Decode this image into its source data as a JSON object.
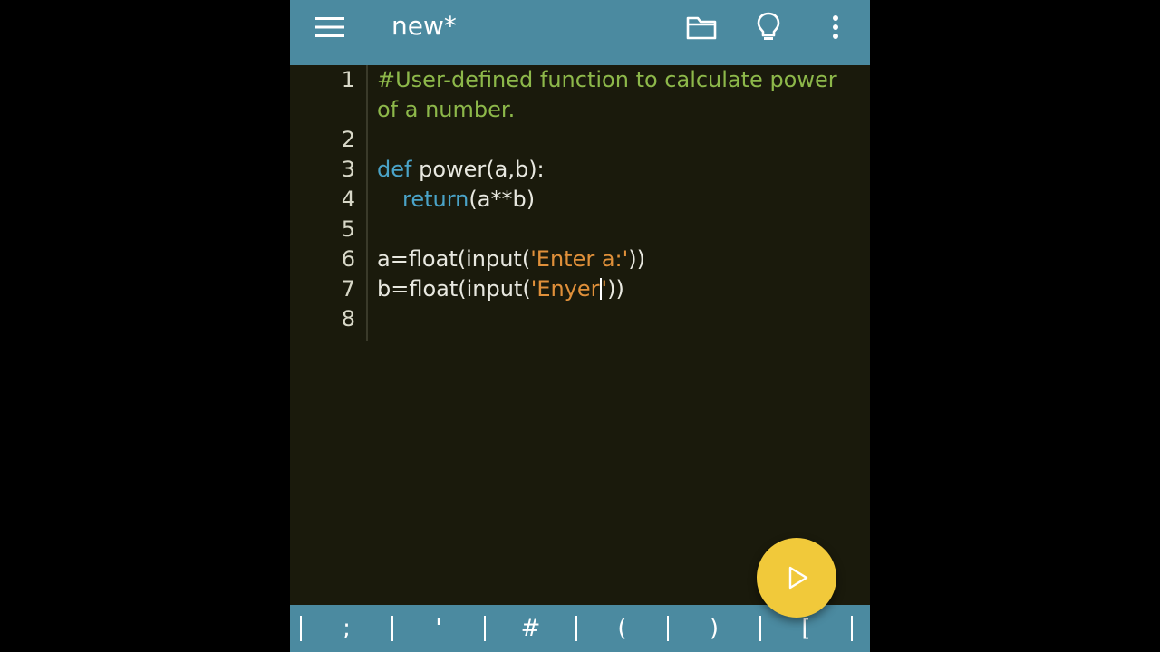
{
  "toolbar": {
    "title": "new*",
    "icons": [
      "menu-icon",
      "folder-icon",
      "lightbulb-icon",
      "more-vertical-icon"
    ],
    "background": "#4b8aa0"
  },
  "editor": {
    "lines": [
      {
        "number": "1",
        "text_a": "#User-defined function to calculate power",
        "text_b": "of a number."
      },
      {
        "number": "2",
        "text": ""
      },
      {
        "number": "3",
        "keyword": "def",
        "text": " power(a,b):"
      },
      {
        "number": "4",
        "keyword": "return",
        "text": "(a**b)"
      },
      {
        "number": "5",
        "text": ""
      },
      {
        "number": "6",
        "prefix": "a=float(input(",
        "string": "'Enter a:'",
        "suffix": "))"
      },
      {
        "number": "7",
        "prefix": "b=float(input(",
        "string_before_cursor": "'Enyer",
        "string_after_cursor": "'",
        "suffix": "))"
      },
      {
        "number": "8",
        "text": ""
      }
    ],
    "colors": {
      "background": "#1a1a0c",
      "comment": "#8db84a",
      "keyword": "#4aa3c8",
      "string": "#e0903a",
      "text": "#e8e8e0"
    }
  },
  "run_button": {
    "icon": "play-icon",
    "color": "#f1c93a"
  },
  "keybar": {
    "keys": [
      ";",
      "'",
      "#",
      "(",
      ")",
      "["
    ]
  }
}
